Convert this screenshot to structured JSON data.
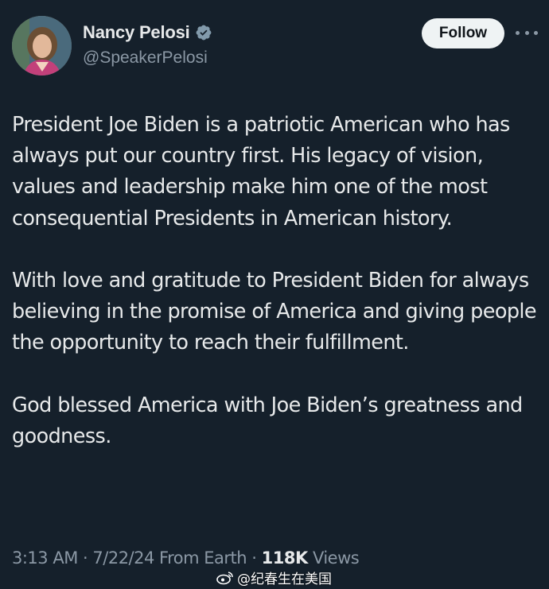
{
  "tweet": {
    "author": {
      "display_name": "Nancy Pelosi",
      "handle": "@SpeakerPelosi",
      "verified": true,
      "verified_badge_color": "#829aab"
    },
    "follow_label": "Follow",
    "paragraphs": [
      "President Joe Biden is a patriotic American who has always put our country first. His legacy of vision, values and leadership make him one of the most consequential Presidents in American history.",
      "With love and gratitude to President Biden for always believing in the promise of America and giving people the opportunity to reach their fulfillment.",
      "God blessed America with Joe Biden’s greatness and goodness."
    ],
    "meta": {
      "time": "3:13 AM",
      "separator": "·",
      "date": "7/22/24",
      "source": "From Earth",
      "views_count": "118K",
      "views_label": "Views"
    }
  },
  "watermark": {
    "text": "@纪春生在美国",
    "icon": "weibo-icon"
  },
  "colors": {
    "background": "#15202b",
    "primary_text": "#e7e9ea",
    "secondary_text": "#8b98a5",
    "follow_button_bg": "#eff3f4"
  }
}
